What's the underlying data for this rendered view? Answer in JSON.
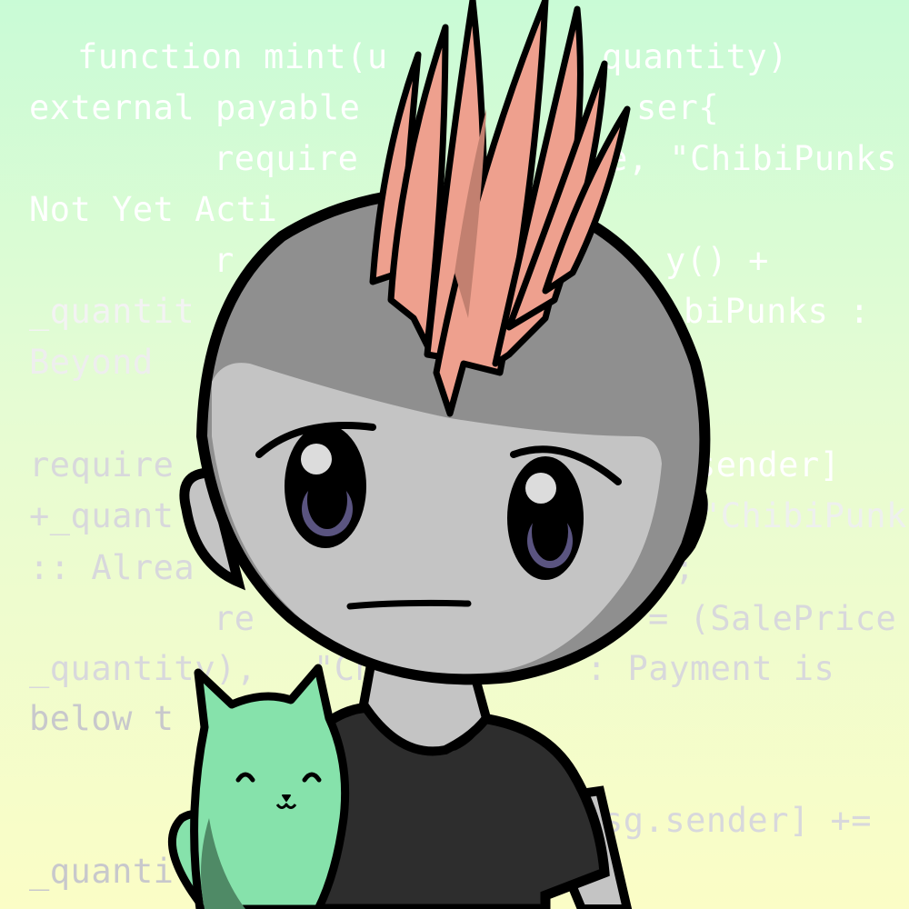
{
  "code_fragments": [
    {
      "text": "function mint(u",
      "tone": "light"
    },
    {
      "text": "quantity)",
      "tone": "light"
    },
    {
      "text": "external payable",
      "tone": "light"
    },
    {
      "text": "ser{",
      "tone": "light"
    },
    {
      "text": "require",
      "tone": "light"
    },
    {
      "text": "e, \"ChibiPunks",
      "tone": "light"
    },
    {
      "text": "Not Yet Acti",
      "tone": "light"
    },
    {
      "text": "r",
      "tone": "light"
    },
    {
      "text": "y() +",
      "tone": "light"
    },
    {
      "text": "_quantit",
      "tone": "light"
    },
    {
      "text": "biPunks :",
      "tone": "light"
    },
    {
      "text": "Beyond",
      "tone": "grey"
    },
    {
      "text": "require",
      "tone": "grey"
    },
    {
      "text": "sender]",
      "tone": "light"
    },
    {
      "text": "+_quant",
      "tone": "grey"
    },
    {
      "text": "\"ChibiPunk",
      "tone": "light"
    },
    {
      "text": ":: Alrea",
      "tone": "grey"
    },
    {
      "text": ";",
      "tone": "grey"
    },
    {
      "text": "re",
      "tone": "grey"
    },
    {
      "text": "= (SalePrice",
      "tone": "grey"
    },
    {
      "text": "_quantity),",
      "tone": "grey"
    },
    {
      "text": "\"Ch",
      "tone": "grey"
    },
    {
      "text": ": Payment is",
      "tone": "grey"
    },
    {
      "text": "below t",
      "tone": "grey"
    },
    {
      "text": "sg.sender] +=",
      "tone": "grey"
    },
    {
      "text": "_quanti",
      "tone": "grey"
    }
  ],
  "colors": {
    "hair": "#eea08e",
    "hair_shade": "#c28070",
    "skin": "#c4c4c4",
    "head_top": "#8f8f8f",
    "shirt": "#2d2d2d",
    "cat": "#86e2ab",
    "cat_shade": "#4f8a66",
    "iris": "#5a5480"
  }
}
